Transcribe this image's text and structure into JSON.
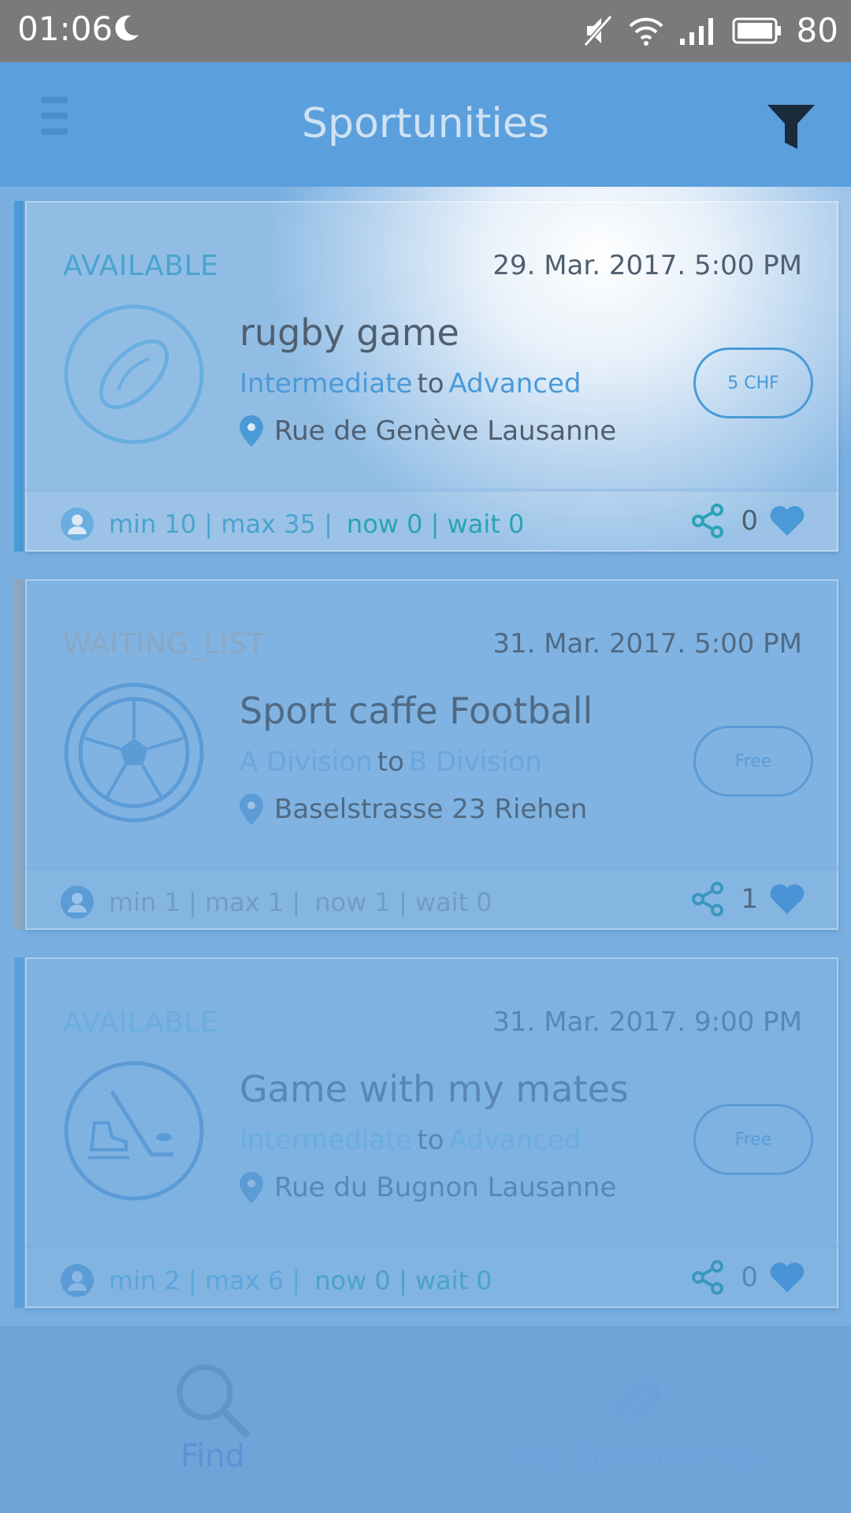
{
  "status_bar": {
    "time": "01:06",
    "battery": "80",
    "icons": [
      "moon-icon",
      "mute-icon",
      "wifi-icon",
      "signal-icon",
      "battery-icon"
    ]
  },
  "app_bar": {
    "title": "Sportunities",
    "icons": [
      "menu-icon",
      "filter-icon"
    ]
  },
  "cards": [
    {
      "status": "AVAILABLE",
      "datetime": "29. Mar. 2017.  5:00 PM",
      "name": "rugby game",
      "level_from": "Intermediate",
      "level_sep": "to",
      "level_to": "Advanced",
      "location": "Rue de Genève Lausanne",
      "price": "5 CHF",
      "stats_main": "min 10 | max 35 |",
      "stats_now": "now 0 | wait 0",
      "likes": "0",
      "sport_icon": "rugby-ball-icon"
    },
    {
      "status": "WAITING_LIST",
      "datetime": "31. Mar. 2017.  5:00 PM",
      "name": "Sport caffe Football",
      "level_from": "A Division",
      "level_sep": "to",
      "level_to": "B Division",
      "location": "Baselstrasse 23 Riehen",
      "price": "Free",
      "stats_main": "min 1 | max 1 |",
      "stats_now": "now 1 | wait 0",
      "likes": "1",
      "sport_icon": "soccer-ball-icon"
    },
    {
      "status": "AVAILABLE",
      "datetime": "31. Mar. 2017.  9:00 PM",
      "name": "Game with my mates",
      "level_from": "Intermediate",
      "level_sep": "to",
      "level_to": "Advanced",
      "location": "Rue du Bugnon Lausanne",
      "price": "Free",
      "stats_main": "min 2 | max 6 |",
      "stats_now": "now 0 | wait 0",
      "likes": "0",
      "sport_icon": "hockey-icon"
    }
  ],
  "bottom_nav": {
    "find": "Find",
    "my": "My Sportunities"
  },
  "colors": {
    "accent": "#4a9ad8",
    "teal": "#2aa3b8",
    "appbar": "#5b9fdd",
    "statusbar": "#7a7a7a"
  }
}
